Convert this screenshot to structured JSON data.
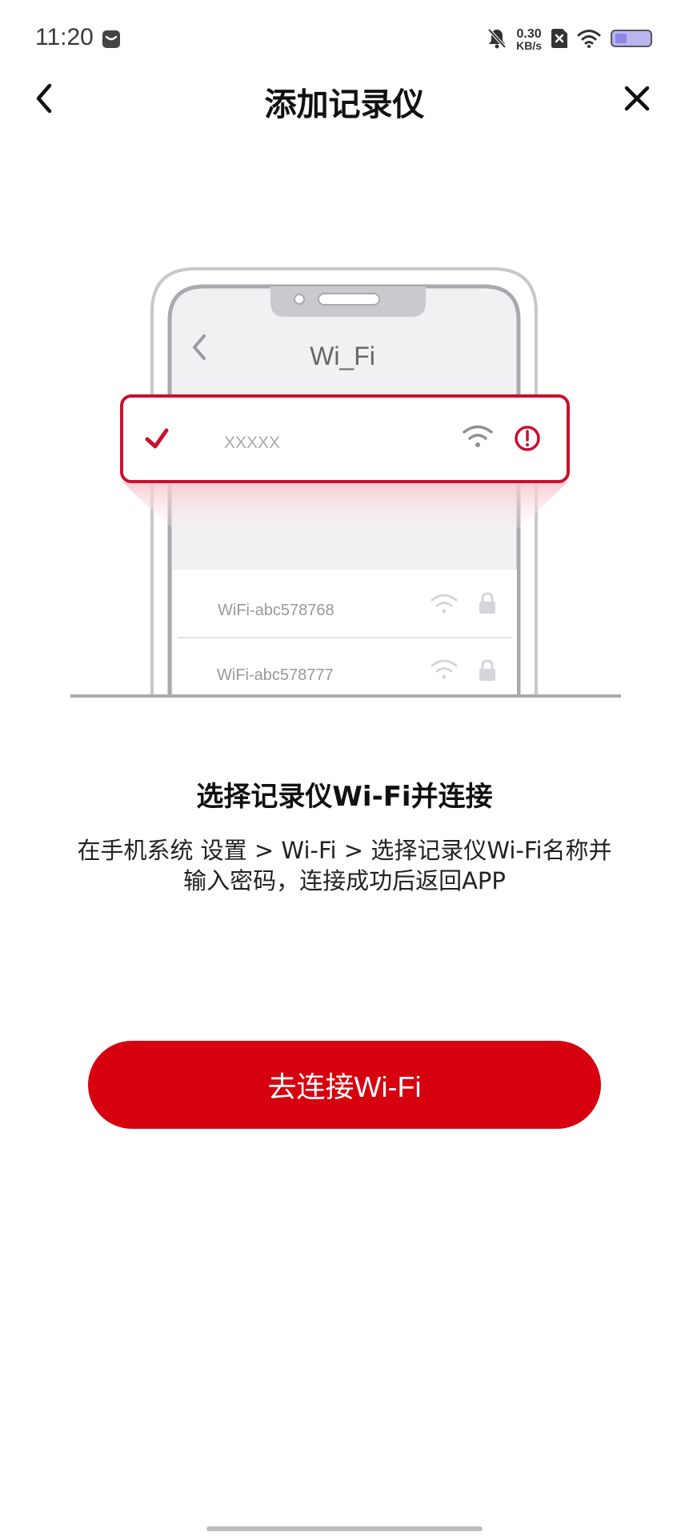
{
  "status_bar": {
    "time": "11:20",
    "net_speed_value": "0.30",
    "net_speed_unit": "KB/s",
    "icons": [
      "message-icon",
      "bell-muted-icon",
      "sim-off-icon",
      "wifi-icon",
      "battery-icon"
    ]
  },
  "header": {
    "title": "添加记录仪",
    "back_icon": "chevron-left-icon",
    "close_icon": "close-icon"
  },
  "illustration": {
    "phone_title": "Wi_Fi",
    "selected_network": "XXXXX",
    "networks": [
      {
        "name": "WiFi-abc578768"
      },
      {
        "name": "WiFi-abc578777"
      }
    ]
  },
  "instruction": {
    "title": "选择记录仪Wi-Fi并连接",
    "line1": "在手机系统 设置 > Wi-Fi > 选择记录仪Wi-Fi名称并",
    "line2": "输入密码，连接成功后返回APP"
  },
  "connect_button": {
    "label": "去连接Wi-Fi"
  },
  "colors": {
    "accent": "#d7000f",
    "text": "#111111",
    "muted": "#bdbdbd"
  }
}
